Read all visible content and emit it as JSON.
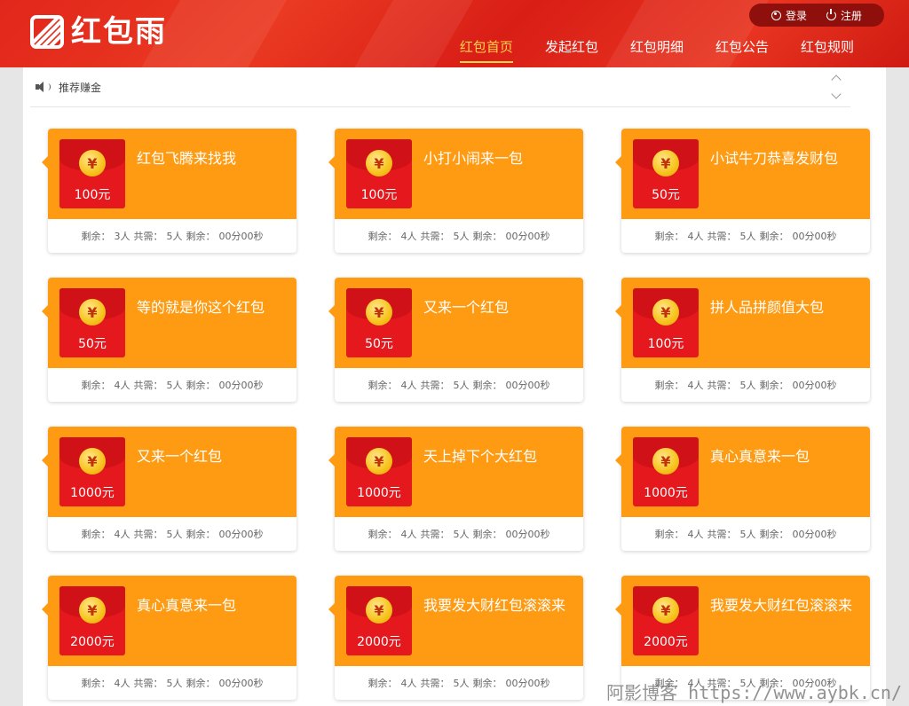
{
  "header": {
    "logo_text": "红包雨",
    "auth": {
      "login": "登录",
      "register": "注册"
    },
    "nav": [
      {
        "label": "红包首页",
        "active": true
      },
      {
        "label": "发起红包",
        "active": false
      },
      {
        "label": "红包明细",
        "active": false
      },
      {
        "label": "红包公告",
        "active": false
      },
      {
        "label": "红包规则",
        "active": false
      }
    ]
  },
  "notice": {
    "text": "推荐赚金"
  },
  "currency_symbol": "¥",
  "info_labels": {
    "remain": "剩余：",
    "total": "共需：",
    "time": "剩余："
  },
  "cards": [
    {
      "title": "红包飞腾来找我",
      "amount": "100元",
      "remain": "3人",
      "total": "5人",
      "time": "00分00秒"
    },
    {
      "title": "小打小闹来一包",
      "amount": "100元",
      "remain": "4人",
      "total": "5人",
      "time": "00分00秒"
    },
    {
      "title": "小试牛刀恭喜发财包",
      "amount": "50元",
      "remain": "4人",
      "total": "5人",
      "time": "00分00秒"
    },
    {
      "title": "等的就是你这个红包",
      "amount": "50元",
      "remain": "4人",
      "total": "5人",
      "time": "00分00秒"
    },
    {
      "title": "又来一个红包",
      "amount": "50元",
      "remain": "4人",
      "total": "5人",
      "time": "00分00秒"
    },
    {
      "title": "拼人品拼颜值大包",
      "amount": "100元",
      "remain": "4人",
      "total": "5人",
      "time": "00分00秒"
    },
    {
      "title": "又来一个红包",
      "amount": "1000元",
      "remain": "4人",
      "total": "5人",
      "time": "00分00秒"
    },
    {
      "title": "天上掉下个大红包",
      "amount": "1000元",
      "remain": "4人",
      "total": "5人",
      "time": "00分00秒"
    },
    {
      "title": "真心真意来一包",
      "amount": "1000元",
      "remain": "4人",
      "total": "5人",
      "time": "00分00秒"
    },
    {
      "title": "真心真意来一包",
      "amount": "2000元",
      "remain": "4人",
      "total": "5人",
      "time": "00分00秒"
    },
    {
      "title": "我要发大财红包滚滚来",
      "amount": "2000元",
      "remain": "4人",
      "total": "5人",
      "time": "00分00秒"
    },
    {
      "title": "我要发大财红包滚滚来",
      "amount": "2000元",
      "remain": "4人",
      "total": "5人",
      "time": "00分00秒"
    }
  ],
  "watermark": "阿影博客 https://www.aybk.cn/"
}
